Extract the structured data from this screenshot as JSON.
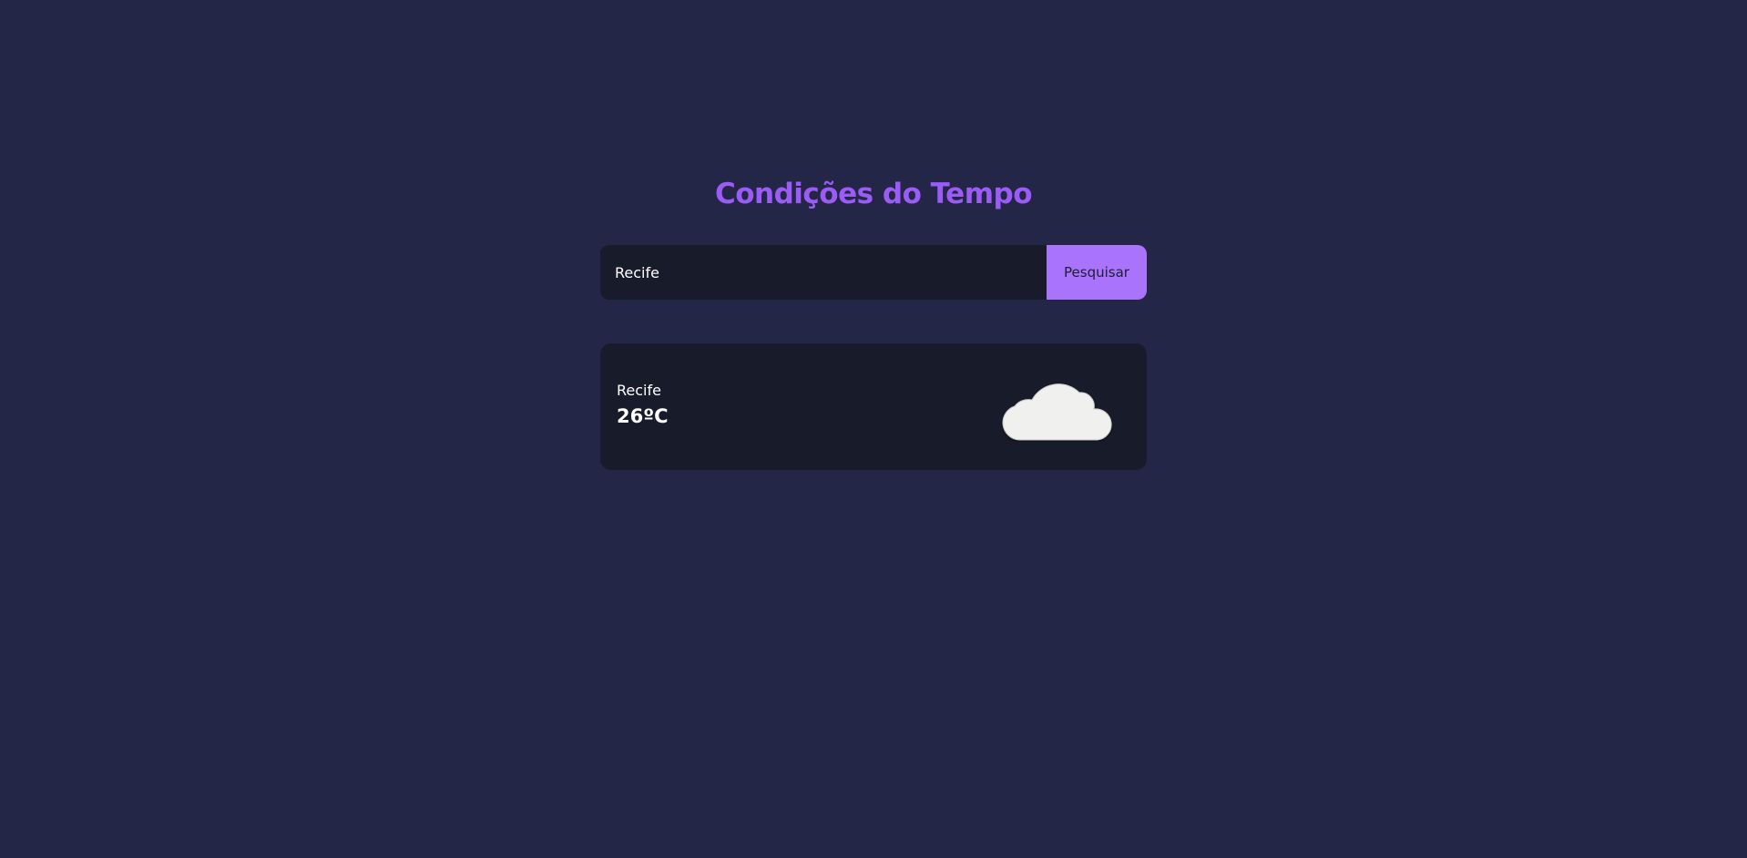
{
  "header": {
    "title": "Condições do Tempo"
  },
  "search": {
    "value": "Recife",
    "button_label": "Pesquisar"
  },
  "weather": {
    "city": "Recife",
    "temperature": "26ºC",
    "icon": "cloud-icon"
  },
  "colors": {
    "background": "#232646",
    "panel": "#181b29",
    "accent": "#a974fb",
    "title": "#9b5cf6",
    "text": "#ffffff"
  }
}
